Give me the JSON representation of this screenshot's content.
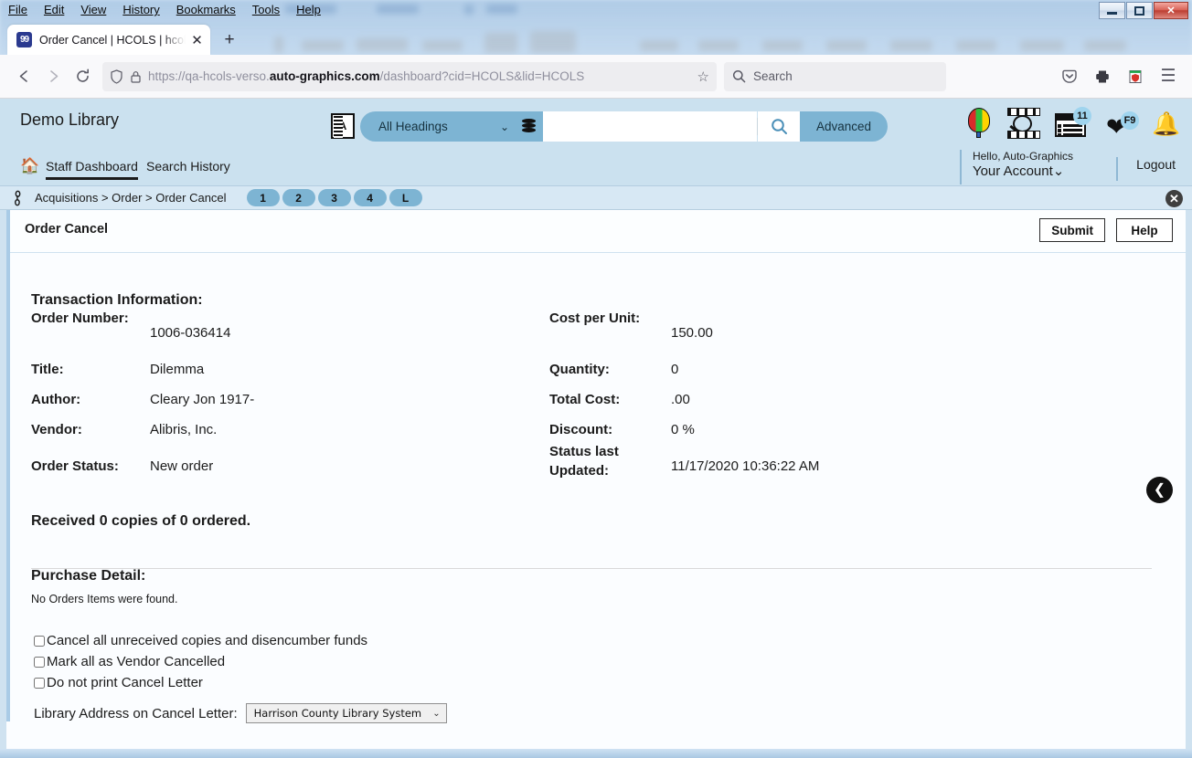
{
  "browser": {
    "menus": [
      "File",
      "Edit",
      "View",
      "History",
      "Bookmarks",
      "Tools",
      "Help"
    ],
    "tab": {
      "title": "Order Cancel | HCOLS | hcols | A",
      "favicon_text": "99",
      "close_label": "✕",
      "newtab_label": "+"
    },
    "window_controls": {
      "minimize": "",
      "maximize": "",
      "close": "✕"
    },
    "nav": {
      "back": "←",
      "forward": "→",
      "reload": "↻",
      "shield": "shield",
      "lock": "lock",
      "url_prefix": "https://qa-hcols-verso.",
      "url_bold": "auto-graphics.com",
      "url_suffix": "/dashboard?cid=HCOLS&lid=HCOLS",
      "bookmark_star": "☆",
      "search_placeholder": "Search",
      "pocket": "pocket-icon",
      "print": "print-icon",
      "extension": "extension-icon",
      "menu": "☰"
    }
  },
  "app_header": {
    "library_name": "Demo Library",
    "search": {
      "scope_label": "All Headings",
      "chevron": "⌄",
      "query_value": "",
      "search_button": "search-icon",
      "advanced_label": "Advanced"
    },
    "icons": {
      "balloon": "balloon-icon",
      "film_search": "film-search-icon",
      "list_badge": "11",
      "heart_badge": "F9",
      "bell": "notification-bell-icon"
    },
    "home_icon": "⌂",
    "nav_links": [
      {
        "label": "Staff Dashboard",
        "active": true
      },
      {
        "label": "Search History",
        "active": false
      }
    ],
    "account": {
      "greeting": "Hello, Auto-Graphics",
      "account_label": "Your Account",
      "chevron": "⌄",
      "logout_label": "Logout"
    }
  },
  "breadcrumb": {
    "chain_icon": "chain-link-icon",
    "path": "Acquisitions > Order > Order Cancel",
    "pages": [
      "1",
      "2",
      "3",
      "4",
      "L"
    ],
    "close_label": "✕"
  },
  "page": {
    "title": "Order Cancel",
    "buttons": {
      "submit": "Submit",
      "help": "Help"
    },
    "back_arrow": "❮"
  },
  "transaction": {
    "heading": "Transaction Information:",
    "left_fields": [
      {
        "label": "Order Number:",
        "value": "1006-036414"
      },
      {
        "label": "Title:",
        "value": "Dilemma"
      },
      {
        "label": "Author:",
        "value": "Cleary Jon 1917-"
      },
      {
        "label": "Vendor:",
        "value": "Alibris, Inc."
      },
      {
        "label": "Order Status:",
        "value": "New order"
      }
    ],
    "right_fields": [
      {
        "label": "Cost per Unit:",
        "value": "150.00"
      },
      {
        "label": "Quantity:",
        "value": "0"
      },
      {
        "label": "Total Cost:",
        "value": ".00"
      },
      {
        "label": "Discount:",
        "value": "0 %"
      },
      {
        "label": "Status last Updated:",
        "value": "11/17/2020 10:36:22 AM"
      }
    ],
    "received_summary": "Received 0 copies of 0 ordered."
  },
  "purchase_detail": {
    "heading": "Purchase Detail:",
    "empty_message": "No Orders Items were found."
  },
  "options": {
    "checkboxes": [
      {
        "label": "Cancel all unreceived copies and disencumber funds",
        "checked": false
      },
      {
        "label": "Mark all as Vendor Cancelled",
        "checked": false
      },
      {
        "label": "Do not print Cancel Letter",
        "checked": false
      }
    ],
    "address_select": {
      "label": "Library Address on Cancel Letter:",
      "value": "Harrison County Library System",
      "chevron": "⌄"
    }
  }
}
